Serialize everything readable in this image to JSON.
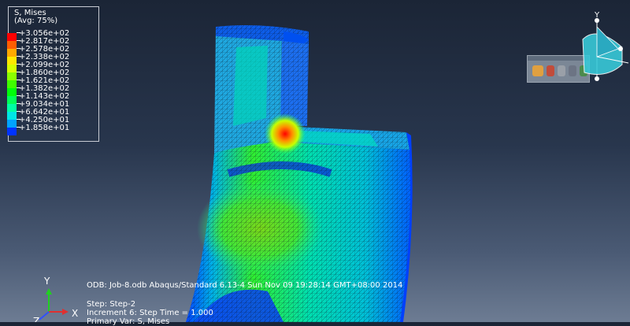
{
  "legend": {
    "title": "S, Mises",
    "subtitle": "(Avg: 75%)",
    "entries": [
      {
        "value": "+3.056e+02",
        "color": "#ff0000"
      },
      {
        "value": "+2.817e+02",
        "color": "#ff5d00"
      },
      {
        "value": "+2.578e+02",
        "color": "#ffa900"
      },
      {
        "value": "+2.338e+02",
        "color": "#ffe800"
      },
      {
        "value": "+2.099e+02",
        "color": "#d6ff00"
      },
      {
        "value": "+1.860e+02",
        "color": "#8bff00"
      },
      {
        "value": "+1.621e+02",
        "color": "#3fff00"
      },
      {
        "value": "+1.382e+02",
        "color": "#00ff0b"
      },
      {
        "value": "+1.143e+02",
        "color": "#00ff58"
      },
      {
        "value": "+9.034e+01",
        "color": "#00ffa4"
      },
      {
        "value": "+6.642e+01",
        "color": "#00e6e6"
      },
      {
        "value": "+4.250e+01",
        "color": "#00a3ff"
      },
      {
        "value": "+1.858e+01",
        "color": "#0033ff"
      }
    ]
  },
  "info": {
    "line1": "ODB: Job-8.odb    Abaqus/Standard 6.13-4    Sun Nov 09 19:28:14 GMT+08:00 2014",
    "line2": "Step: Step-2",
    "line3": "Increment      6: Step Time =     1.000",
    "line4": "Primary Var: S, Mises"
  },
  "axes": {
    "y": "Y",
    "x": "X",
    "z": "Z"
  },
  "triad": {
    "label": "Y",
    "y_color": "#38c9d8"
  },
  "toolbar": {
    "icons": [
      "view-icon",
      "rotate-icon",
      "pan-icon",
      "zoom-icon",
      "fit-icon"
    ]
  }
}
